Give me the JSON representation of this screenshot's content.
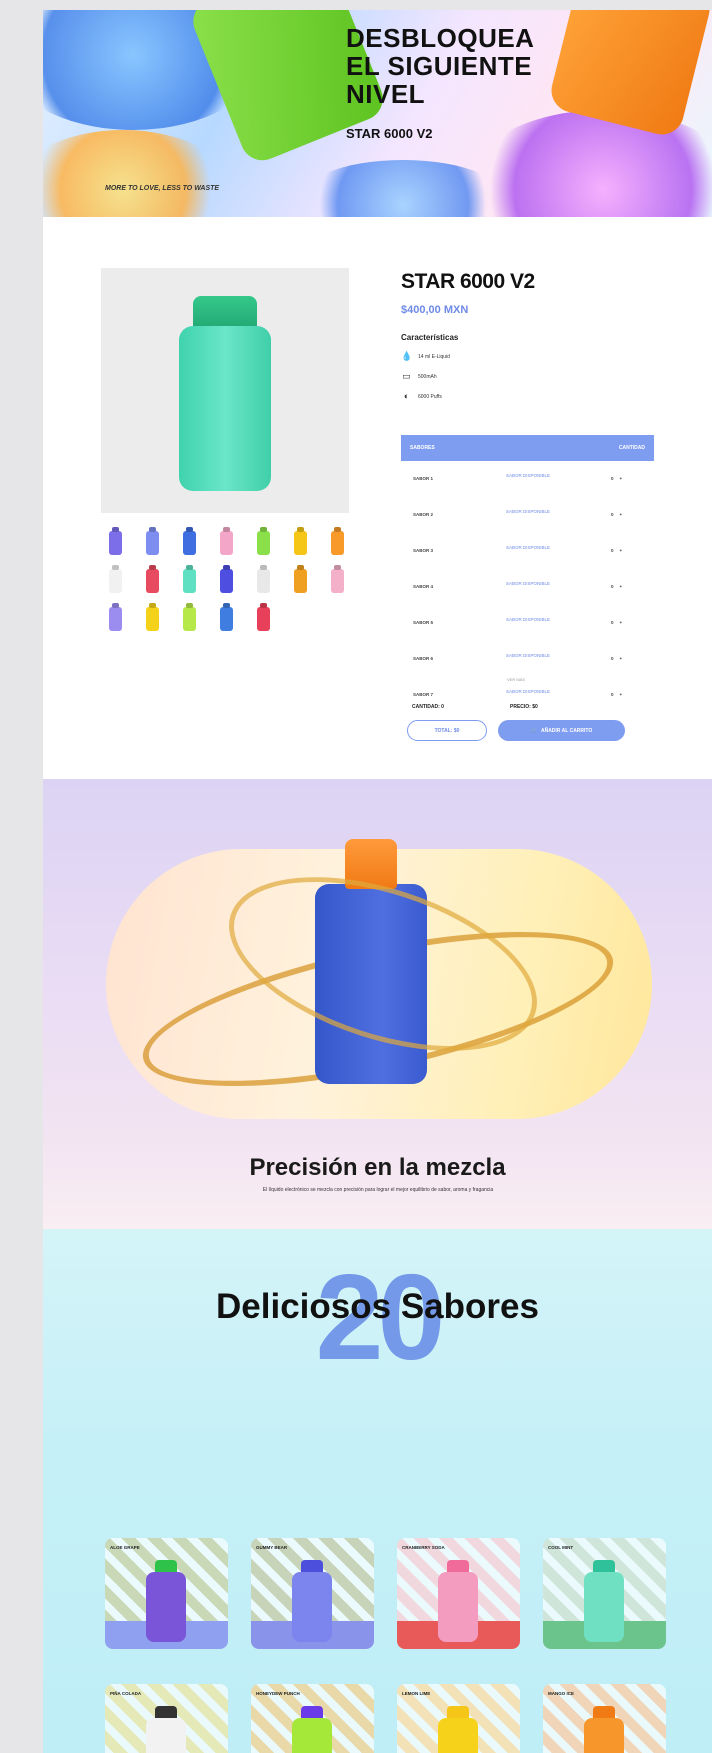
{
  "hero": {
    "title_lines": [
      "DESBLOQUEA",
      "EL SIGUIENTE",
      "NIVEL"
    ],
    "subtitle": "STAR 6000 V2",
    "tagline": "MORE TO LOVE, LESS TO WASTE"
  },
  "product": {
    "title": "STAR 6000 V2",
    "price": "$400,00 MXN",
    "features_title": "Características",
    "features": [
      {
        "icon": "liquid-icon",
        "label": "14 ml E-Liquid"
      },
      {
        "icon": "battery-icon",
        "label": "500mAh"
      },
      {
        "icon": "puffs-icon",
        "label": "6000 Puffs"
      }
    ],
    "thumb_colors": [
      "#7b6ee8",
      "#7d8ef0",
      "#3f6ee0",
      "#f4a6c8",
      "#8be04a",
      "#f5c518",
      "#f79a2a",
      "#f1f1f1",
      "#e84a5f",
      "#5fe0c2",
      "#4e4ee0",
      "#e8e8e8",
      "#f0a020",
      "#f3b0c8",
      "#9b8cf0",
      "#f5d21a",
      "#b7e84a",
      "#3f7de0",
      "#e8405a"
    ]
  },
  "table": {
    "head_flavor": "SABORES",
    "head_qty": "CANTIDAD",
    "rows": [
      {
        "name": "SABOR 1",
        "status": "SABOR DISPONIBLE",
        "qty": "0"
      },
      {
        "name": "SABOR 2",
        "status": "SABOR DISPONIBLE",
        "qty": "0"
      },
      {
        "name": "SABOR 3",
        "status": "SABOR DISPONIBLE",
        "qty": "0"
      },
      {
        "name": "SABOR 4",
        "status": "SABOR DISPONIBLE",
        "qty": "0"
      },
      {
        "name": "SABOR 5",
        "status": "SABOR DISPONIBLE",
        "qty": "0"
      },
      {
        "name": "SABOR 6",
        "status": "SABOR DISPONIBLE",
        "qty": "0"
      },
      {
        "name": "SABOR 7",
        "status": "SABOR DISPONIBLE",
        "qty": "0"
      }
    ],
    "more_link": "VER MÁS",
    "qty_label": "CANTIDAD: 0",
    "price_label": "PRECIO: $0",
    "total_label": "TOTAL: $0",
    "cart_button": "AÑADIR AL CARRITO"
  },
  "precision": {
    "title": "Precisión en la mezcla",
    "description": "El líquido electrónico se mezcla con precisión para lograr el mejor equilibrio de sabor, aroma y fragancia"
  },
  "flavors": {
    "big_number": "20",
    "title": "Deliciosos Sabores",
    "cards": [
      {
        "label": "ALOE GRAPE",
        "pod": "#7a55d8",
        "cap": "#2fc24a",
        "band": "#8fa0f0",
        "bg": "#c9d9b8"
      },
      {
        "label": "GUMMY BEAR",
        "pod": "#7c85ee",
        "cap": "#4b4fdc",
        "band": "#8a93ea",
        "bg": "#c8d4b9"
      },
      {
        "label": "CRANBERRY SODA",
        "pod": "#f49cc0",
        "cap": "#f06a9a",
        "band": "#e85a5a",
        "bg": "#f1d7de"
      },
      {
        "label": "COOL MINT",
        "pod": "#6fe0c2",
        "cap": "#2fc29a",
        "band": "#6bc48c",
        "bg": "#cfe5da"
      },
      {
        "label": "PIÑA COLADA",
        "pod": "#f2f2f2",
        "cap": "#333333",
        "band": "#f0a0a0",
        "bg": "#e5e9b8"
      },
      {
        "label": "HONEYDEW PUNCH",
        "pod": "#a6e83a",
        "cap": "#6b3ae8",
        "band": "#f4e07a",
        "bg": "#e9d8a8"
      },
      {
        "label": "LEMON LIME",
        "pod": "#f7d21a",
        "cap": "#f5c518",
        "band": "#f0c860",
        "bg": "#f3e1b8"
      },
      {
        "label": "MANGO ICE",
        "pod": "#f7962a",
        "cap": "#f07a14",
        "band": "#f3a050",
        "bg": "#f1d5b8"
      }
    ]
  }
}
